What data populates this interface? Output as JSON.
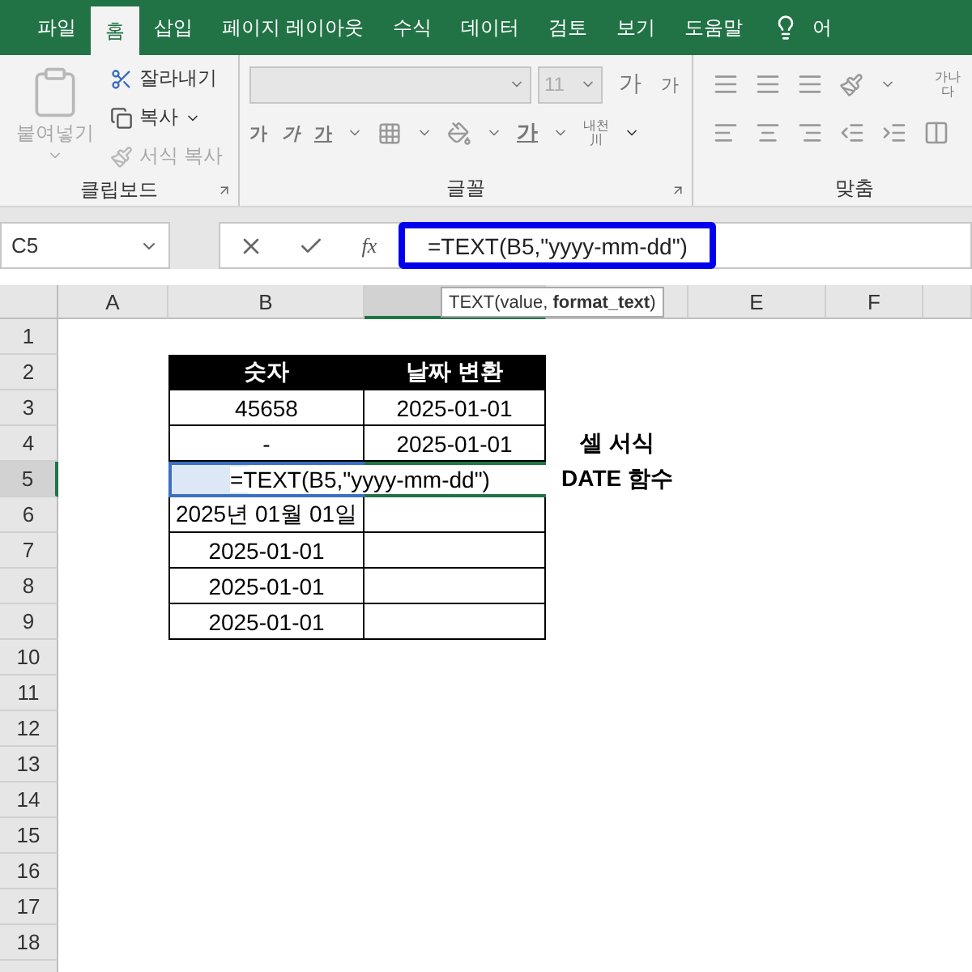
{
  "tabs": [
    {
      "label": "파일",
      "selected": false
    },
    {
      "label": "홈",
      "selected": true
    },
    {
      "label": "삽입",
      "selected": false
    },
    {
      "label": "페이지 레이아웃",
      "selected": false
    },
    {
      "label": "수식",
      "selected": false
    },
    {
      "label": "데이터",
      "selected": false
    },
    {
      "label": "검토",
      "selected": false
    },
    {
      "label": "보기",
      "selected": false
    },
    {
      "label": "도움말",
      "selected": false
    }
  ],
  "tell_me": "어",
  "ribbon": {
    "groups": [
      {
        "label": "클립보드",
        "launcher": true
      },
      {
        "label": "글꼴",
        "launcher": true
      },
      {
        "label": "맞춤",
        "launcher": false
      }
    ],
    "clipboard": {
      "paste": {
        "label": "붙여넣기",
        "disabled": true
      },
      "cut": {
        "label": "잘라내기",
        "disabled": false
      },
      "copy": {
        "label": "복사",
        "disabled": false
      },
      "format_painter": {
        "label": "서식 복사",
        "disabled": true
      }
    },
    "font": {
      "size": "11",
      "grow": "가",
      "shrink": "가",
      "bold": "가",
      "italic": "가",
      "underline": "가",
      "font_color": "가",
      "phonetic_top": "내천",
      "phonetic_bottom": "川"
    },
    "alignment": {
      "wrap_top": "가나",
      "wrap_bottom": "다"
    }
  },
  "formula_bar": {
    "name_box": "C5",
    "fx": "fx",
    "formula": "=TEXT(B5,\"yyyy-mm-dd\")",
    "highlighted": true
  },
  "tooltip": "TEXT(value, **format_text**)",
  "columns": [
    {
      "label": "A",
      "selected": false
    },
    {
      "label": "B",
      "selected": false
    },
    {
      "selected": true
    },
    {
      "selected": false
    },
    {
      "label": "E",
      "selected": false
    },
    {
      "label": "F",
      "selected": false
    },
    {
      "selected": false
    }
  ],
  "rows": [
    {
      "label": "1",
      "selected": false
    },
    {
      "label": "2",
      "selected": false
    },
    {
      "label": "3",
      "selected": false
    },
    {
      "label": "4",
      "selected": false
    },
    {
      "label": "5",
      "selected": true
    },
    {
      "label": "6",
      "selected": false
    },
    {
      "label": "7",
      "selected": false
    },
    {
      "label": "8",
      "selected": false
    },
    {
      "label": "9",
      "selected": false
    },
    {
      "label": "10",
      "selected": false
    },
    {
      "label": "11",
      "selected": false
    },
    {
      "label": "12",
      "selected": false
    },
    {
      "label": "13",
      "selected": false
    },
    {
      "label": "14",
      "selected": false
    },
    {
      "label": "15",
      "selected": false
    },
    {
      "label": "16",
      "selected": false
    },
    {
      "label": "17",
      "selected": false
    },
    {
      "label": "18",
      "selected": false
    }
  ],
  "table": {
    "header": [
      "숫자",
      "날짜 변환"
    ],
    "rows": [
      {
        "kind": "values",
        "number": "45658",
        "date": "2025-01-01"
      },
      {
        "kind": "values",
        "number": "-",
        "date": "2025-01-01"
      },
      {
        "kind": "editing",
        "text": "=TEXT(B5,\"yyyy-mm-dd\")"
      },
      {
        "kind": "values",
        "number": "2025년 01월 01일"
      },
      {
        "kind": "values",
        "number": "2025-01-01"
      },
      {
        "kind": "values",
        "number": "2025-01-01"
      },
      {
        "kind": "values",
        "number": "2025-01-01"
      }
    ]
  },
  "notes": [
    "셀 서식",
    "DATE 함수"
  ]
}
